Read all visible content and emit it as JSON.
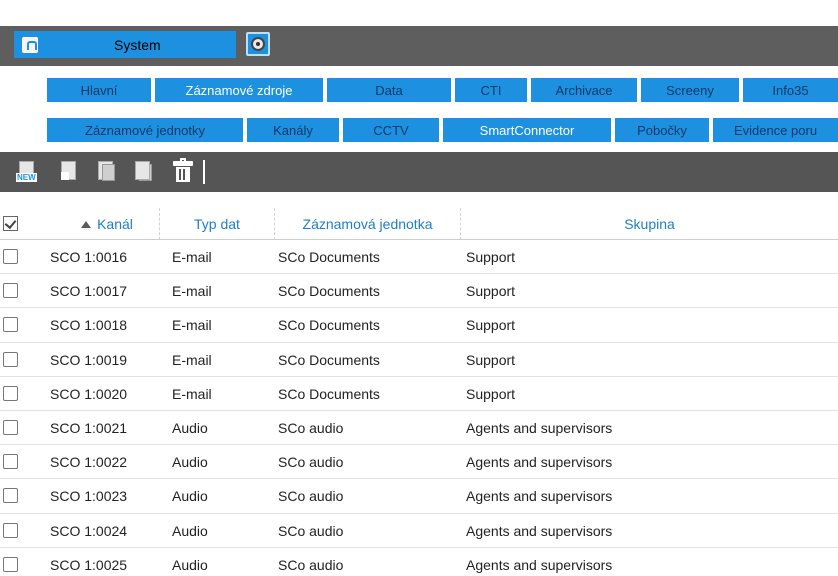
{
  "header": {
    "system_label": "System"
  },
  "tabs_main": [
    {
      "label": "Hlavní",
      "active": false
    },
    {
      "label": "Záznamové zdroje",
      "active": true
    },
    {
      "label": "Data",
      "active": false
    },
    {
      "label": "CTI",
      "active": false
    },
    {
      "label": "Archivace",
      "active": false
    },
    {
      "label": "Screeny",
      "active": false
    },
    {
      "label": "Info35",
      "active": false
    }
  ],
  "tabs_sub": [
    {
      "label": "Záznamové jednotky",
      "active": false
    },
    {
      "label": "Kanály",
      "active": false
    },
    {
      "label": "CCTV",
      "active": false
    },
    {
      "label": "SmartConnector",
      "active": true
    },
    {
      "label": "Pobočky",
      "active": false
    },
    {
      "label": "Evidence poru",
      "active": false
    }
  ],
  "toolbar": {
    "new_badge": "NEW"
  },
  "table": {
    "columns": [
      "Kanál",
      "Typ dat",
      "Záznamová jednotka",
      "Skupina"
    ],
    "rows": [
      [
        "SCO 1:0016",
        "E-mail",
        "SCo Documents",
        "Support"
      ],
      [
        "SCO 1:0017",
        "E-mail",
        "SCo Documents",
        "Support"
      ],
      [
        "SCO 1:0018",
        "E-mail",
        "SCo Documents",
        "Support"
      ],
      [
        "SCO 1:0019",
        "E-mail",
        "SCo Documents",
        "Support"
      ],
      [
        "SCO 1:0020",
        "E-mail",
        "SCo Documents",
        "Support"
      ],
      [
        "SCO 1:0021",
        "Audio",
        "SCo audio",
        "Agents and supervisors"
      ],
      [
        "SCO 1:0022",
        "Audio",
        "SCo audio",
        "Agents and supervisors"
      ],
      [
        "SCO 1:0023",
        "Audio",
        "SCo audio",
        "Agents and supervisors"
      ],
      [
        "SCO 1:0024",
        "Audio",
        "SCo audio",
        "Agents and supervisors"
      ],
      [
        "SCO 1:0025",
        "Audio",
        "SCo audio",
        "Agents and supervisors"
      ]
    ]
  },
  "colors": {
    "accent": "#1e90e0",
    "header_bg": "#5e5e5e",
    "toolbar_bg": "#555555",
    "column_header_text": "#1e7ec8"
  }
}
